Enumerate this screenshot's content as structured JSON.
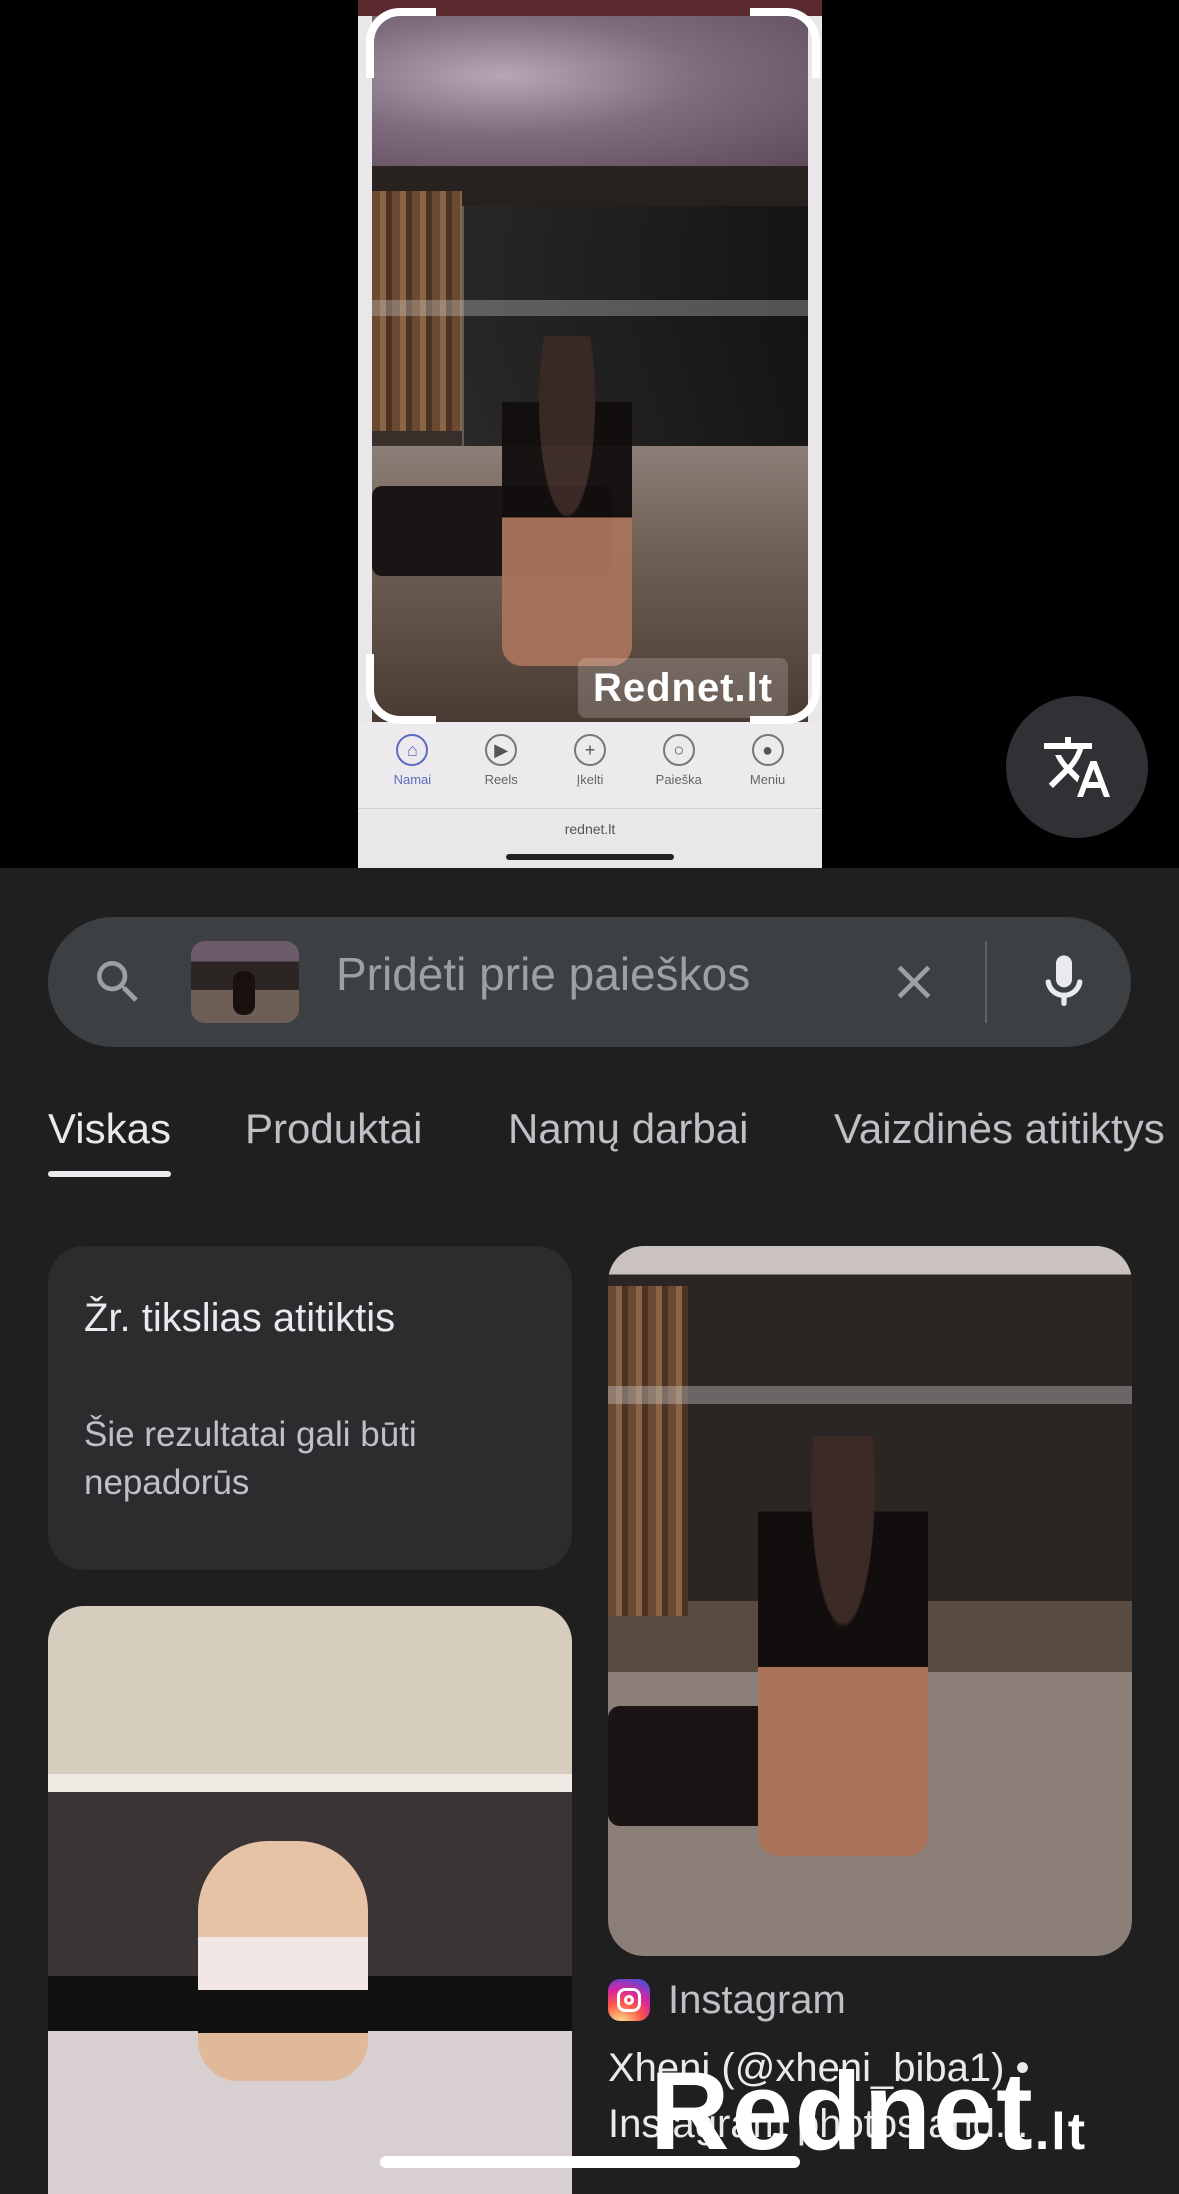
{
  "preview": {
    "watermark": "Rednet.lt",
    "phone_nav": [
      {
        "label": "Namai",
        "icon": "home-icon",
        "active": true
      },
      {
        "label": "Reels",
        "icon": "reels-icon",
        "active": false
      },
      {
        "label": "Įkelti",
        "icon": "upload-icon",
        "active": false
      },
      {
        "label": "Paieška",
        "icon": "search-icon",
        "active": false
      },
      {
        "label": "Meniu",
        "icon": "avatar-icon",
        "active": false
      }
    ],
    "phone_url": "rednet.lt",
    "translate_icon": "translate-icon"
  },
  "search": {
    "placeholder": "Pridėti prie paieškos"
  },
  "tabs": [
    {
      "label": "Viskas",
      "active": true
    },
    {
      "label": "Produktai",
      "active": false
    },
    {
      "label": "Namų darbai",
      "active": false
    },
    {
      "label": "Vaizdinės atitiktys",
      "active": false
    }
  ],
  "exact_card": {
    "title": "Žr. tikslias atitiktis",
    "subtitle": "Šie rezultatai gali būti nepadorūs"
  },
  "result_right": {
    "source": "Instagram",
    "title": "Xheni (@xheni_biba1) • Instagram photos and..."
  },
  "overlay_watermark": {
    "main": "Rednet",
    "suffix": ".lt"
  },
  "colors": {
    "background": "#1f1f1f",
    "searchbar": "#3c4043",
    "card": "#2c2c2e"
  }
}
